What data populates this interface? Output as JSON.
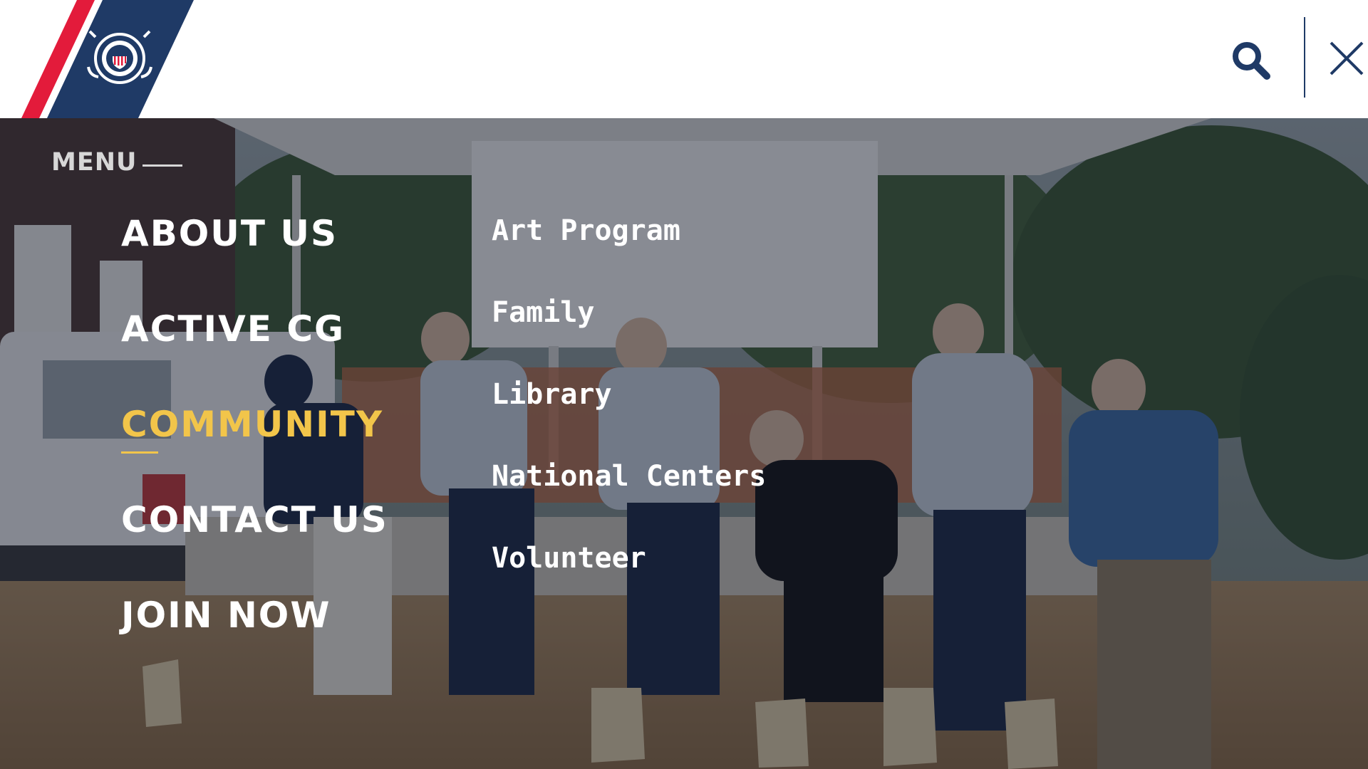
{
  "header": {
    "logo_name": "coast-guard-seal",
    "stripe_colors": {
      "red": "#e31b3b",
      "blue": "#1f3a66"
    },
    "search_icon": "search-icon",
    "close_icon": "close-icon"
  },
  "menu": {
    "heading": "MENU",
    "primary_items": [
      {
        "label": "ABOUT US",
        "active": false
      },
      {
        "label": "ACTIVE CG",
        "active": false
      },
      {
        "label": "COMMUNITY",
        "active": true
      },
      {
        "label": "CONTACT US",
        "active": false
      },
      {
        "label": "JOIN NOW",
        "active": false
      }
    ],
    "sub_items": [
      {
        "label": "Art Program"
      },
      {
        "label": "Family"
      },
      {
        "label": "Library"
      },
      {
        "label": "National Centers"
      },
      {
        "label": "Volunteer"
      }
    ]
  },
  "colors": {
    "accent": "#f2c54a",
    "brand_blue": "#1f3a66",
    "brand_red": "#e31b3b",
    "menu_text": "#ffffff"
  }
}
